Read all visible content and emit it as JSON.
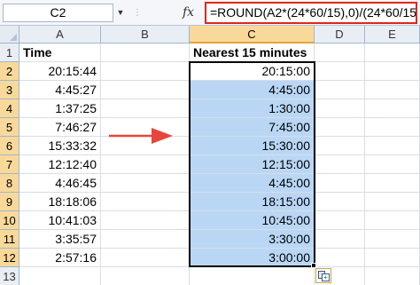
{
  "formula_bar": {
    "name_box": "C2",
    "fx": "fx",
    "formula": "=ROUND(A2*(24*60/15),0)/(24*60/15)"
  },
  "columns": [
    "A",
    "B",
    "C",
    "D",
    "E"
  ],
  "rows": [
    "1",
    "2",
    "3",
    "4",
    "5",
    "6",
    "7",
    "8",
    "9",
    "10",
    "11",
    "12",
    "13",
    "14"
  ],
  "headers": {
    "a1": "Time",
    "c1": "Nearest 15 minutes"
  },
  "column_a": [
    "20:15:44",
    "4:45:27",
    "1:37:25",
    "7:46:27",
    "15:33:32",
    "12:12:40",
    "4:46:45",
    "18:18:06",
    "10:41:03",
    "3:35:57",
    "2:57:16"
  ],
  "column_c": [
    "20:15:00",
    "4:45:00",
    "1:30:00",
    "7:45:00",
    "15:30:00",
    "12:15:00",
    "4:45:00",
    "18:15:00",
    "10:45:00",
    "3:30:00",
    "3:00:00"
  ],
  "colors": {
    "selection_fill": "#b9d7f5",
    "formula_highlight": "#e0271b",
    "arrow": "#e8453c",
    "header_selected": "#f9d99a"
  }
}
